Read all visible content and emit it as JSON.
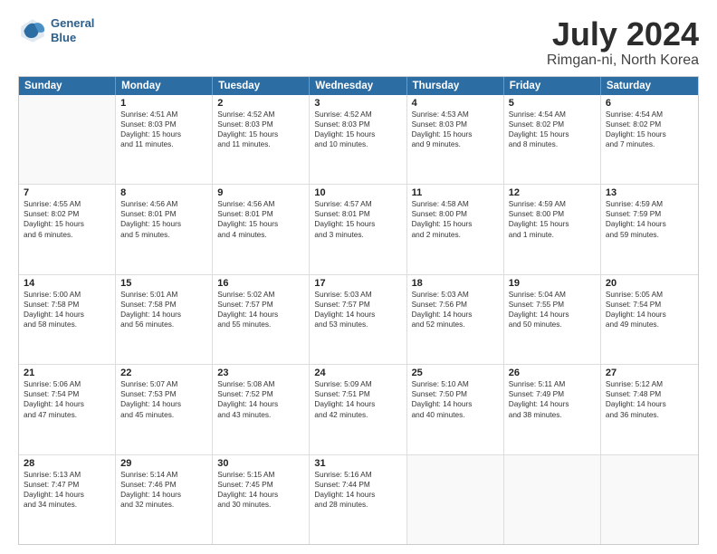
{
  "header": {
    "logo_line1": "General",
    "logo_line2": "Blue",
    "title": "July 2024",
    "subtitle": "Rimgan-ni, North Korea"
  },
  "calendar": {
    "days": [
      "Sunday",
      "Monday",
      "Tuesday",
      "Wednesday",
      "Thursday",
      "Friday",
      "Saturday"
    ],
    "weeks": [
      [
        {
          "day": "",
          "empty": true
        },
        {
          "day": "1",
          "lines": [
            "Sunrise: 4:51 AM",
            "Sunset: 8:03 PM",
            "Daylight: 15 hours",
            "and 11 minutes."
          ]
        },
        {
          "day": "2",
          "lines": [
            "Sunrise: 4:52 AM",
            "Sunset: 8:03 PM",
            "Daylight: 15 hours",
            "and 11 minutes."
          ]
        },
        {
          "day": "3",
          "lines": [
            "Sunrise: 4:52 AM",
            "Sunset: 8:03 PM",
            "Daylight: 15 hours",
            "and 10 minutes."
          ]
        },
        {
          "day": "4",
          "lines": [
            "Sunrise: 4:53 AM",
            "Sunset: 8:03 PM",
            "Daylight: 15 hours",
            "and 9 minutes."
          ]
        },
        {
          "day": "5",
          "lines": [
            "Sunrise: 4:54 AM",
            "Sunset: 8:02 PM",
            "Daylight: 15 hours",
            "and 8 minutes."
          ]
        },
        {
          "day": "6",
          "lines": [
            "Sunrise: 4:54 AM",
            "Sunset: 8:02 PM",
            "Daylight: 15 hours",
            "and 7 minutes."
          ]
        }
      ],
      [
        {
          "day": "7",
          "lines": [
            "Sunrise: 4:55 AM",
            "Sunset: 8:02 PM",
            "Daylight: 15 hours",
            "and 6 minutes."
          ]
        },
        {
          "day": "8",
          "lines": [
            "Sunrise: 4:56 AM",
            "Sunset: 8:01 PM",
            "Daylight: 15 hours",
            "and 5 minutes."
          ]
        },
        {
          "day": "9",
          "lines": [
            "Sunrise: 4:56 AM",
            "Sunset: 8:01 PM",
            "Daylight: 15 hours",
            "and 4 minutes."
          ]
        },
        {
          "day": "10",
          "lines": [
            "Sunrise: 4:57 AM",
            "Sunset: 8:01 PM",
            "Daylight: 15 hours",
            "and 3 minutes."
          ]
        },
        {
          "day": "11",
          "lines": [
            "Sunrise: 4:58 AM",
            "Sunset: 8:00 PM",
            "Daylight: 15 hours",
            "and 2 minutes."
          ]
        },
        {
          "day": "12",
          "lines": [
            "Sunrise: 4:59 AM",
            "Sunset: 8:00 PM",
            "Daylight: 15 hours",
            "and 1 minute."
          ]
        },
        {
          "day": "13",
          "lines": [
            "Sunrise: 4:59 AM",
            "Sunset: 7:59 PM",
            "Daylight: 14 hours",
            "and 59 minutes."
          ]
        }
      ],
      [
        {
          "day": "14",
          "lines": [
            "Sunrise: 5:00 AM",
            "Sunset: 7:58 PM",
            "Daylight: 14 hours",
            "and 58 minutes."
          ]
        },
        {
          "day": "15",
          "lines": [
            "Sunrise: 5:01 AM",
            "Sunset: 7:58 PM",
            "Daylight: 14 hours",
            "and 56 minutes."
          ]
        },
        {
          "day": "16",
          "lines": [
            "Sunrise: 5:02 AM",
            "Sunset: 7:57 PM",
            "Daylight: 14 hours",
            "and 55 minutes."
          ]
        },
        {
          "day": "17",
          "lines": [
            "Sunrise: 5:03 AM",
            "Sunset: 7:57 PM",
            "Daylight: 14 hours",
            "and 53 minutes."
          ]
        },
        {
          "day": "18",
          "lines": [
            "Sunrise: 5:03 AM",
            "Sunset: 7:56 PM",
            "Daylight: 14 hours",
            "and 52 minutes."
          ]
        },
        {
          "day": "19",
          "lines": [
            "Sunrise: 5:04 AM",
            "Sunset: 7:55 PM",
            "Daylight: 14 hours",
            "and 50 minutes."
          ]
        },
        {
          "day": "20",
          "lines": [
            "Sunrise: 5:05 AM",
            "Sunset: 7:54 PM",
            "Daylight: 14 hours",
            "and 49 minutes."
          ]
        }
      ],
      [
        {
          "day": "21",
          "lines": [
            "Sunrise: 5:06 AM",
            "Sunset: 7:54 PM",
            "Daylight: 14 hours",
            "and 47 minutes."
          ]
        },
        {
          "day": "22",
          "lines": [
            "Sunrise: 5:07 AM",
            "Sunset: 7:53 PM",
            "Daylight: 14 hours",
            "and 45 minutes."
          ]
        },
        {
          "day": "23",
          "lines": [
            "Sunrise: 5:08 AM",
            "Sunset: 7:52 PM",
            "Daylight: 14 hours",
            "and 43 minutes."
          ]
        },
        {
          "day": "24",
          "lines": [
            "Sunrise: 5:09 AM",
            "Sunset: 7:51 PM",
            "Daylight: 14 hours",
            "and 42 minutes."
          ]
        },
        {
          "day": "25",
          "lines": [
            "Sunrise: 5:10 AM",
            "Sunset: 7:50 PM",
            "Daylight: 14 hours",
            "and 40 minutes."
          ]
        },
        {
          "day": "26",
          "lines": [
            "Sunrise: 5:11 AM",
            "Sunset: 7:49 PM",
            "Daylight: 14 hours",
            "and 38 minutes."
          ]
        },
        {
          "day": "27",
          "lines": [
            "Sunrise: 5:12 AM",
            "Sunset: 7:48 PM",
            "Daylight: 14 hours",
            "and 36 minutes."
          ]
        }
      ],
      [
        {
          "day": "28",
          "lines": [
            "Sunrise: 5:13 AM",
            "Sunset: 7:47 PM",
            "Daylight: 14 hours",
            "and 34 minutes."
          ]
        },
        {
          "day": "29",
          "lines": [
            "Sunrise: 5:14 AM",
            "Sunset: 7:46 PM",
            "Daylight: 14 hours",
            "and 32 minutes."
          ]
        },
        {
          "day": "30",
          "lines": [
            "Sunrise: 5:15 AM",
            "Sunset: 7:45 PM",
            "Daylight: 14 hours",
            "and 30 minutes."
          ]
        },
        {
          "day": "31",
          "lines": [
            "Sunrise: 5:16 AM",
            "Sunset: 7:44 PM",
            "Daylight: 14 hours",
            "and 28 minutes."
          ]
        },
        {
          "day": "",
          "empty": true
        },
        {
          "day": "",
          "empty": true
        },
        {
          "day": "",
          "empty": true
        }
      ]
    ]
  }
}
